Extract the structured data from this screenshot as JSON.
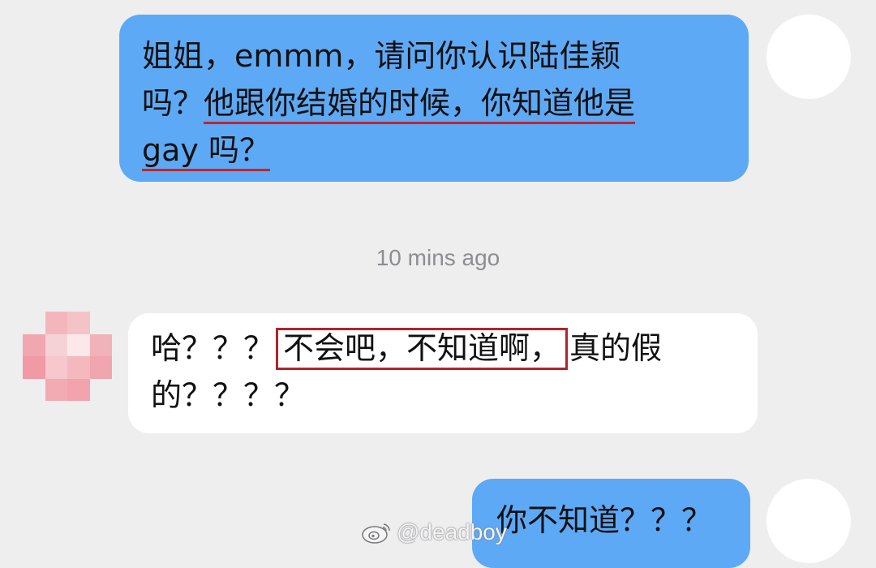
{
  "messages": {
    "m1": {
      "line1": "姐姐，emmm，请问你认识陆佳颖",
      "line2_prefix": "吗？",
      "line2_highlight": "他跟你结婚的时候，你知道他是",
      "line3_highlight": "gay 吗？"
    },
    "timestamp": "10 mins ago",
    "m2": {
      "line1_prefix": "哈？？？",
      "line1_boxed": "不会吧，不知道啊，",
      "line1_suffix": "真的假",
      "line2": "的？？？？"
    },
    "m3": {
      "text": "你不知道？？？"
    }
  },
  "watermark": {
    "handle": "@deadboy"
  },
  "colors": {
    "outgoing_bubble": "#5ea9f5",
    "incoming_bubble": "#ffffff",
    "background": "#eeeeef",
    "highlight_red": "#c0262b"
  },
  "icons": {
    "watermark_icon": "weibo-logo",
    "incoming_avatar": "pixelated-avatar",
    "outgoing_avatar": "blank-avatar"
  }
}
